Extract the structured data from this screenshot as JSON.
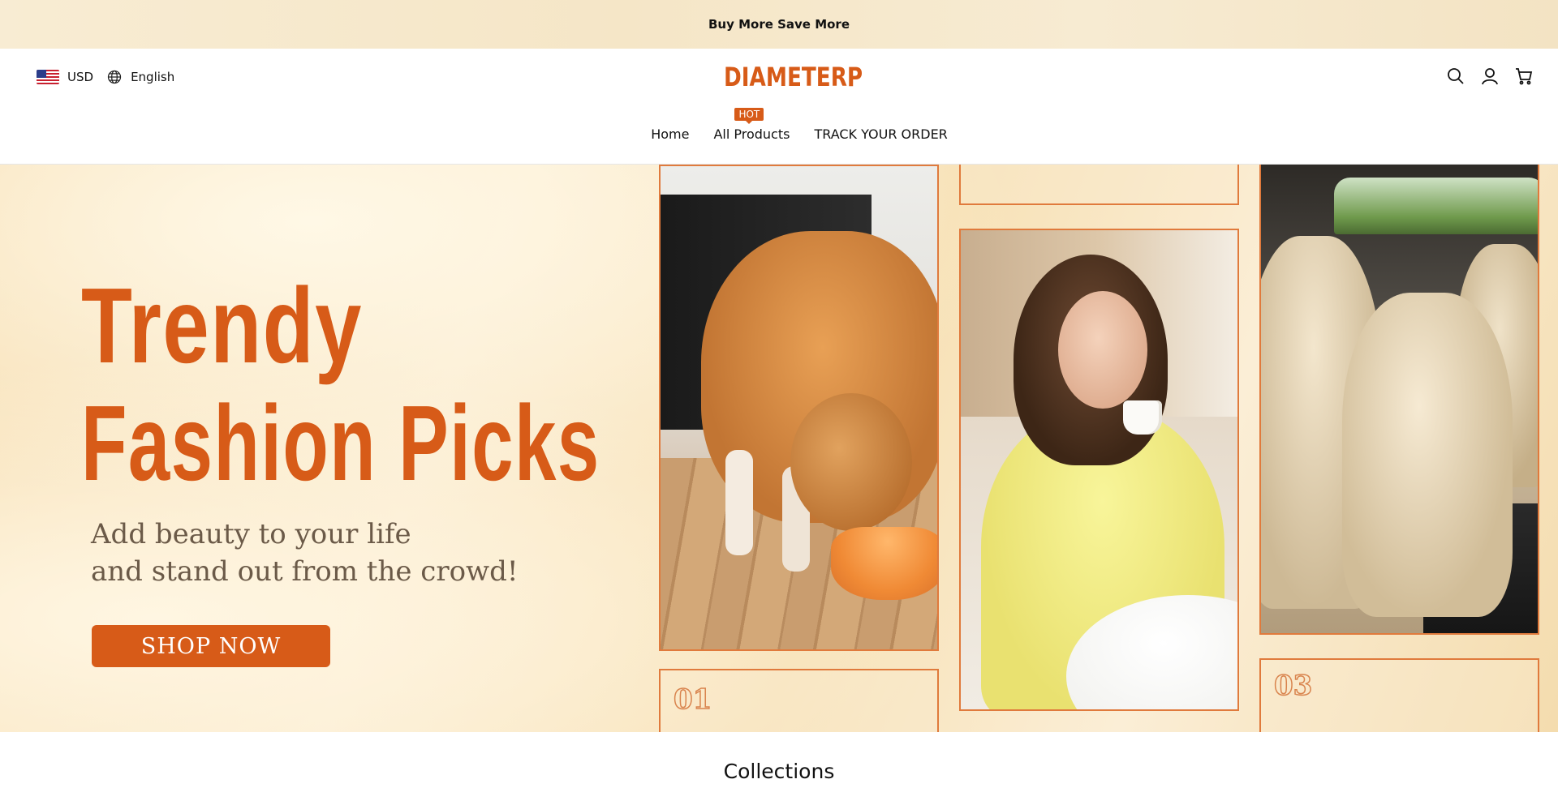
{
  "announcement": {
    "text": "Buy More Save More"
  },
  "header": {
    "currency": "USD",
    "language": "English",
    "logo": "DIAMETERP",
    "icons": [
      "search-icon",
      "account-icon",
      "cart-icon"
    ]
  },
  "nav": {
    "items": [
      {
        "label": "Home"
      },
      {
        "label": "All Products",
        "badge": "HOT"
      },
      {
        "label": "TRACK YOUR ORDER"
      }
    ]
  },
  "hero": {
    "title_line1": "Trendy",
    "title_line2": "Fashion Picks",
    "subtitle_line1": "Add beauty to your life",
    "subtitle_line2": "and stand out from the crowd!",
    "cta": "SHOP NOW",
    "card_numbers": [
      "01",
      "03"
    ]
  },
  "collections": {
    "title": "Collections"
  },
  "colors": {
    "brand": "#d75b18",
    "announcement_bg": "#f6e8cc"
  }
}
